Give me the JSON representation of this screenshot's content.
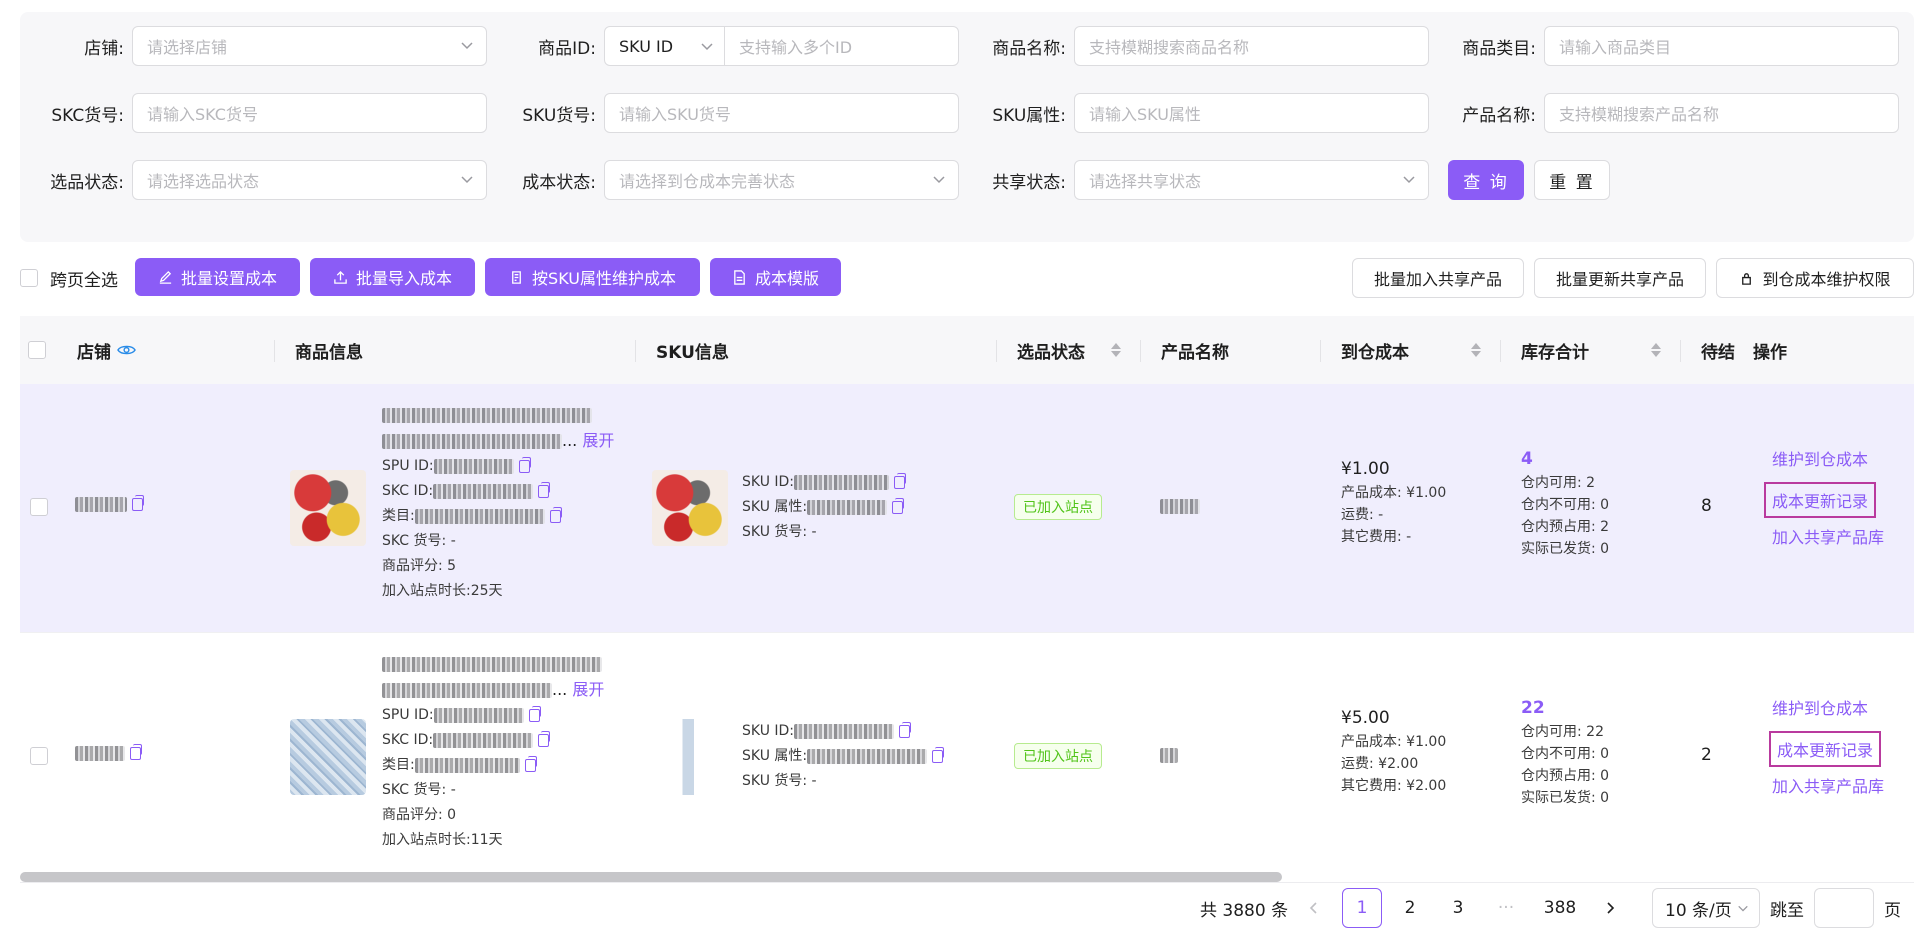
{
  "filters": {
    "store": {
      "label": "店铺:",
      "placeholder": "请选择店铺"
    },
    "product_id": {
      "label": "商品ID:",
      "type_value": "SKU ID",
      "placeholder": "支持输入多个ID"
    },
    "product_name": {
      "label": "商品名称:",
      "placeholder": "支持模糊搜索商品名称"
    },
    "category": {
      "label": "商品类目:",
      "placeholder": "请输入商品类目"
    },
    "skc_no": {
      "label": "SKC货号:",
      "placeholder": "请输入SKC货号"
    },
    "sku_no": {
      "label": "SKU货号:",
      "placeholder": "请输入SKU货号"
    },
    "sku_attr": {
      "label": "SKU属性:",
      "placeholder": "请输入SKU属性"
    },
    "item_name": {
      "label": "产品名称:",
      "placeholder": "支持模糊搜索产品名称"
    },
    "select_status": {
      "label": "选品状态:",
      "placeholder": "请选择选品状态"
    },
    "cost_status": {
      "label": "成本状态:",
      "placeholder": "请选择到仓成本完善状态"
    },
    "share_status": {
      "label": "共享状态:",
      "placeholder": "请选择共享状态"
    },
    "query_label": "查 询",
    "reset_label": "重 置"
  },
  "toolbar": {
    "cross_page_select": "跨页全选",
    "batch_set_cost": "批量设置成本",
    "batch_import_cost": "批量导入成本",
    "sku_attr_cost": "按SKU属性维护成本",
    "cost_template": "成本模版",
    "batch_add_share": "批量加入共享产品",
    "batch_update_share": "批量更新共享产品",
    "cost_permission": "到仓成本维护权限"
  },
  "table": {
    "columns": [
      "店铺",
      "商品信息",
      "SKU信息",
      "选品状态",
      "产品名称",
      "到仓成本",
      "库存合计",
      "待结",
      "操作"
    ],
    "rows": [
      {
        "expand": "展开",
        "spu_label": "SPU ID:",
        "skc_label": "SKC ID:",
        "category_label": "类目:",
        "skc_no": "SKC 货号: -",
        "rating": "商品评分: 5",
        "duration_label": "加入站点时长:",
        "duration": "25天",
        "sku_id_label": "SKU ID:",
        "sku_attr_label": "SKU 属性:",
        "sku_no": "SKU 货号: -",
        "status": "已加入站点",
        "cost": "¥1.00",
        "product_cost": "产品成本: ¥1.00",
        "freight": "运费:  -",
        "other_cost": "其它费用:  -",
        "stock_total": "4",
        "avail": "仓内可用:  2",
        "unavail": "仓内不可用:  0",
        "reserved": "仓内预占用:  2",
        "shipped": "实际已发货:  0",
        "pending": "8",
        "op_maintain": "维护到仓成本",
        "op_records": "成本更新记录",
        "op_share": "加入共享产品库"
      },
      {
        "expand": "展开",
        "spu_label": "SPU ID:",
        "skc_label": "SKC ID:",
        "category_label": "类目:",
        "skc_no": "SKC 货号: -",
        "rating": "商品评分: 0",
        "duration_label": "加入站点时长:",
        "duration": "11天",
        "sku_id_label": "SKU ID:",
        "sku_attr_label": "SKU 属性:",
        "sku_no": "SKU 货号: -",
        "status": "已加入站点",
        "cost": "¥5.00",
        "product_cost": "产品成本: ¥1.00",
        "freight": "运费: ¥2.00",
        "other_cost": "其它费用: ¥2.00",
        "stock_total": "22",
        "avail": "仓内可用:  22",
        "unavail": "仓内不可用:  0",
        "reserved": "仓内预占用:  0",
        "shipped": "实际已发货:  0",
        "pending": "2",
        "op_maintain": "维护到仓成本",
        "op_records": "成本更新记录",
        "op_share": "加入共享产品库"
      }
    ]
  },
  "pagination": {
    "total": "共 3880 条",
    "pages": [
      "1",
      "2",
      "3",
      "···",
      "388"
    ],
    "current": "1",
    "page_size": "10 条/页",
    "jump_label": "跳至",
    "page_suffix": "页"
  },
  "colors": {
    "accent": "#8b5cf6",
    "row_highlight": "#f0eefd",
    "tag_green": "#52c41a"
  }
}
